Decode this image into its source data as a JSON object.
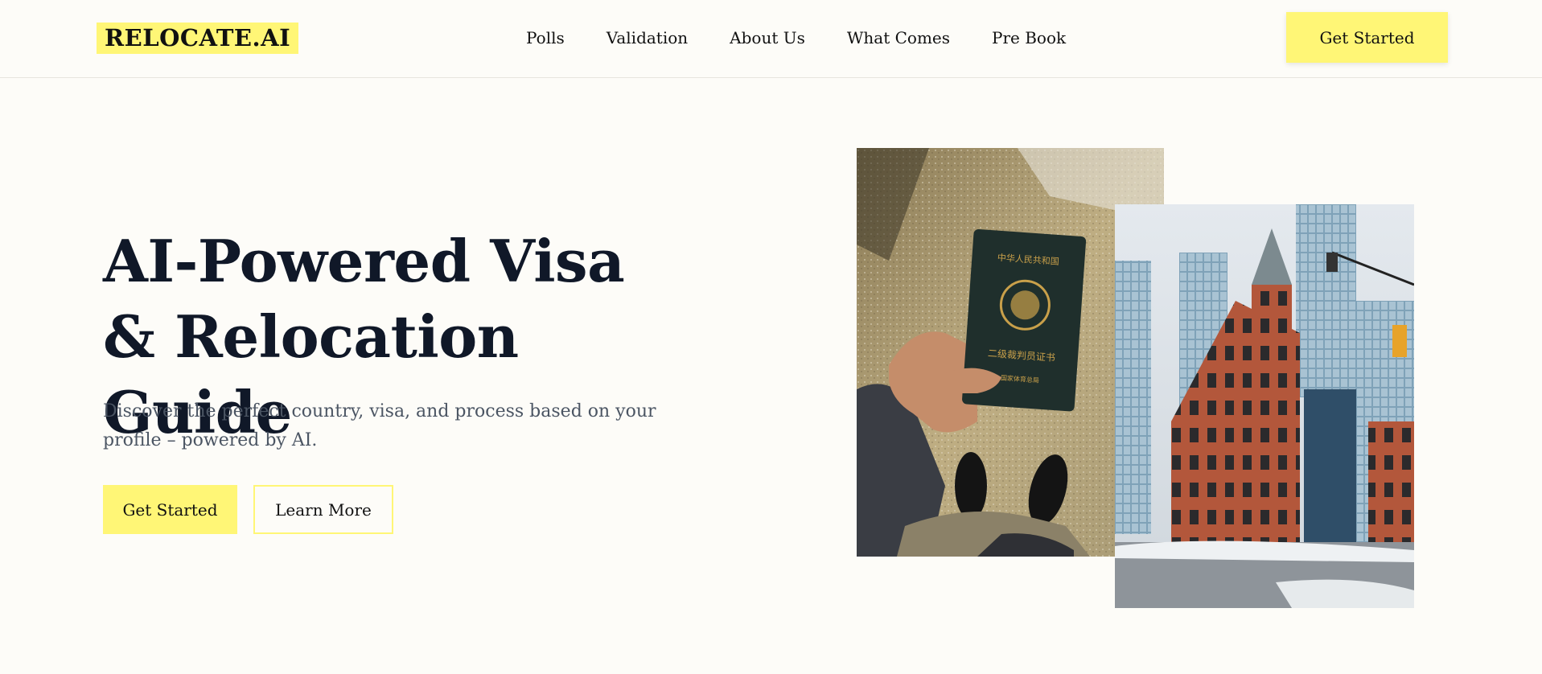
{
  "brand": {
    "logo_text": "RELOCATE.AI"
  },
  "nav": {
    "items": [
      {
        "label": "Polls"
      },
      {
        "label": "Validation"
      },
      {
        "label": "About Us"
      },
      {
        "label": "What Comes"
      },
      {
        "label": "Pre Book"
      }
    ],
    "cta_label": "Get Started"
  },
  "hero": {
    "title": "AI-Powered Visa & Relocation Guide",
    "subtitle": "Discover the perfect country, visa, and process based on your profile – powered by AI.",
    "primary_button": "Get Started",
    "secondary_button": "Learn More"
  },
  "images": {
    "passport_photo": {
      "passport_header_text": "中华人民共和国",
      "passport_title_text": "二级裁判员证书",
      "passport_issuer_text": "国家体育总局"
    },
    "city_photo": {}
  },
  "colors": {
    "accent": "#fff676",
    "background": "#fdfcf8",
    "heading": "#101828",
    "body_text": "#4b5563"
  }
}
